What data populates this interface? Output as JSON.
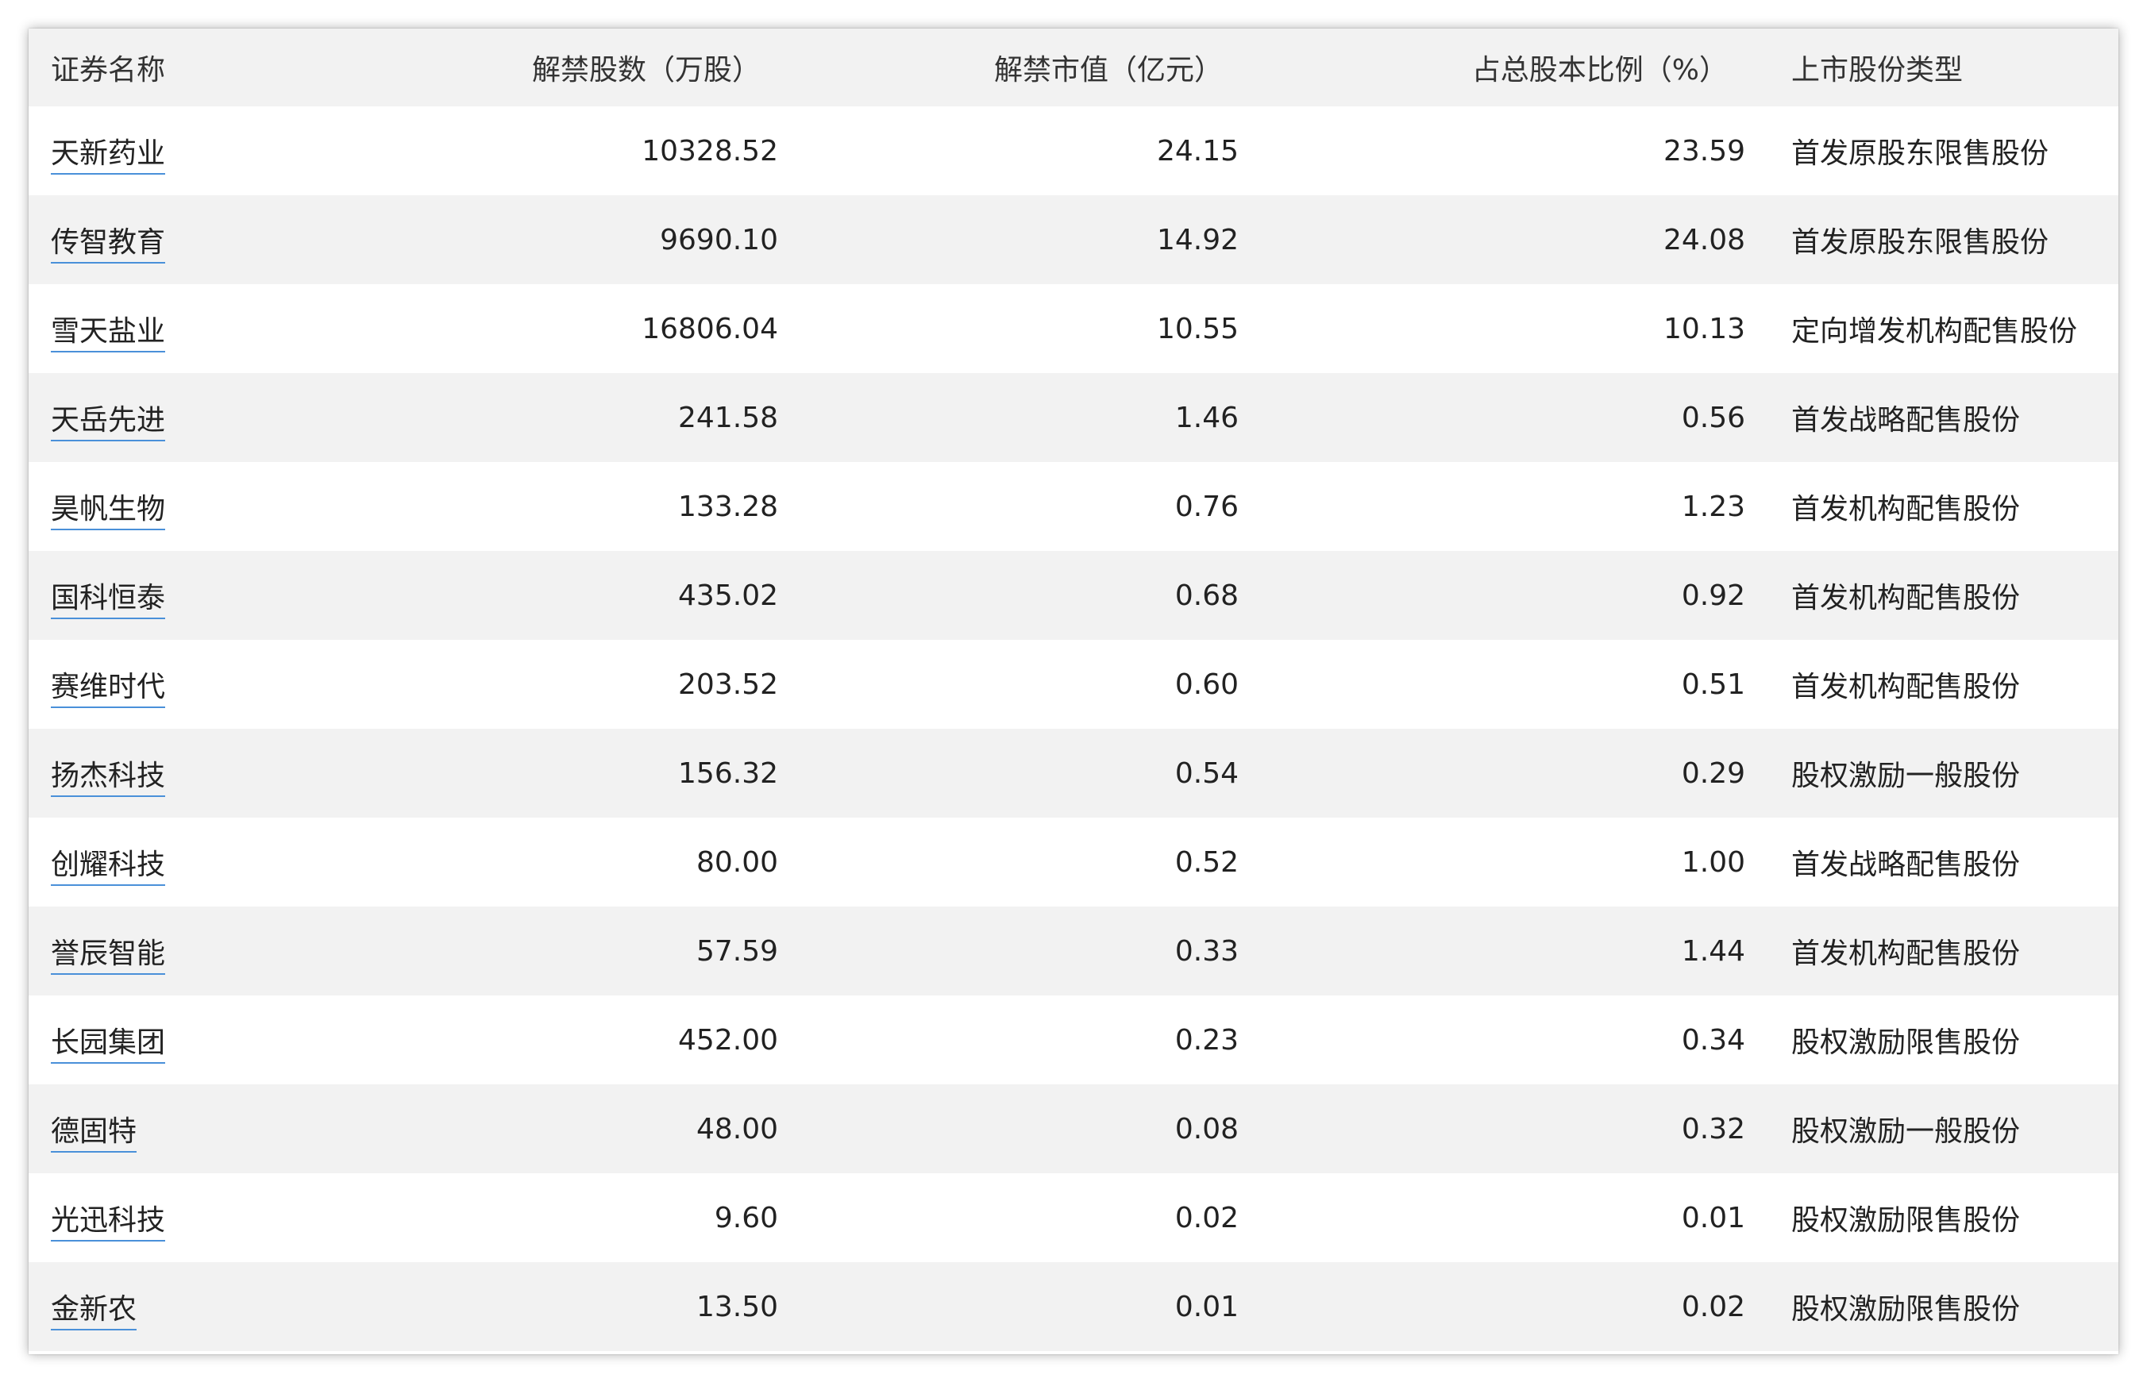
{
  "table": {
    "headers": [
      "证券名称",
      "解禁股数（万股）",
      "解禁市值（亿元）",
      "占总股本比例（%）",
      "上市股份类型"
    ],
    "rows": [
      {
        "name": "天新药业",
        "shares": "10328.52",
        "value": "24.15",
        "ratio": "23.59",
        "type": "首发原股东限售股份"
      },
      {
        "name": "传智教育",
        "shares": "9690.10",
        "value": "14.92",
        "ratio": "24.08",
        "type": "首发原股东限售股份"
      },
      {
        "name": "雪天盐业",
        "shares": "16806.04",
        "value": "10.55",
        "ratio": "10.13",
        "type": "定向增发机构配售股份"
      },
      {
        "name": "天岳先进",
        "shares": "241.58",
        "value": "1.46",
        "ratio": "0.56",
        "type": "首发战略配售股份"
      },
      {
        "name": "昊帆生物",
        "shares": "133.28",
        "value": "0.76",
        "ratio": "1.23",
        "type": "首发机构配售股份"
      },
      {
        "name": "国科恒泰",
        "shares": "435.02",
        "value": "0.68",
        "ratio": "0.92",
        "type": "首发机构配售股份"
      },
      {
        "name": "赛维时代",
        "shares": "203.52",
        "value": "0.60",
        "ratio": "0.51",
        "type": "首发机构配售股份"
      },
      {
        "name": "扬杰科技",
        "shares": "156.32",
        "value": "0.54",
        "ratio": "0.29",
        "type": "股权激励一般股份"
      },
      {
        "name": "创耀科技",
        "shares": "80.00",
        "value": "0.52",
        "ratio": "1.00",
        "type": "首发战略配售股份"
      },
      {
        "name": "誉辰智能",
        "shares": "57.59",
        "value": "0.33",
        "ratio": "1.44",
        "type": "首发机构配售股份"
      },
      {
        "name": "长园集团",
        "shares": "452.00",
        "value": "0.23",
        "ratio": "0.34",
        "type": "股权激励限售股份"
      },
      {
        "name": "德固特",
        "shares": "48.00",
        "value": "0.08",
        "ratio": "0.32",
        "type": "股权激励一般股份"
      },
      {
        "name": "光迅科技",
        "shares": "9.60",
        "value": "0.02",
        "ratio": "0.01",
        "type": "股权激励限售股份"
      },
      {
        "name": "金新农",
        "shares": "13.50",
        "value": "0.01",
        "ratio": "0.02",
        "type": "股权激励限售股份"
      }
    ]
  },
  "colors": {
    "header_bg": "#f2f2f2",
    "stripe_bg": "#f2f2f2",
    "link_underline": "#4a90d9",
    "text": "#222222"
  }
}
